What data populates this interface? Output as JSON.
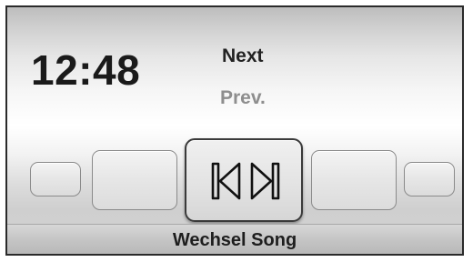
{
  "status": {
    "clock": "12:48"
  },
  "menu": {
    "items": [
      {
        "label": "Next",
        "state": "active"
      },
      {
        "label": "Prev.",
        "state": "inactive"
      }
    ]
  },
  "carousel": {
    "selected": {
      "icon": "skip-prev-next-icon",
      "label": "Wechsel Song"
    },
    "tiles": [
      "empty",
      "empty",
      "skip-prev-next-icon",
      "empty",
      "empty"
    ]
  },
  "colors": {
    "text_primary": "#1a1a1a",
    "text_inactive": "#8e8e8e",
    "frame": "#2a2a2a"
  }
}
